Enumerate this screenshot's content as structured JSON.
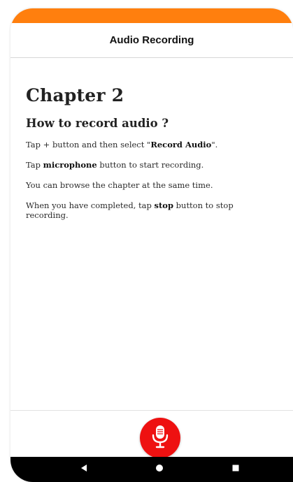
{
  "app_bar": {
    "title": "Audio Recording"
  },
  "content": {
    "chapter_title": "Chapter 2",
    "section_title": "How to record audio ?",
    "paragraphs": [
      {
        "segments": [
          {
            "text": "Tap + button and then select \"",
            "bold": false
          },
          {
            "text": "Record Audio",
            "bold": true
          },
          {
            "text": "\".",
            "bold": false
          }
        ]
      },
      {
        "segments": [
          {
            "text": "Tap ",
            "bold": false
          },
          {
            "text": "microphone",
            "bold": true
          },
          {
            "text": " button to start recording.",
            "bold": false
          }
        ]
      },
      {
        "segments": [
          {
            "text": "You can browse the chapter at the same time.",
            "bold": false
          }
        ]
      },
      {
        "segments": [
          {
            "text": "When you have completed, tap ",
            "bold": false
          },
          {
            "text": "stop",
            "bold": true
          },
          {
            "text": " button to stop recording.",
            "bold": false
          }
        ]
      }
    ]
  },
  "bottom_bar": {
    "record_button_icon": "microphone-icon"
  },
  "nav_bar": {
    "back_icon": "back-triangle-icon",
    "home_icon": "home-circle-icon",
    "recents_icon": "recents-square-icon"
  },
  "colors": {
    "status_bar": "#ff7f0e",
    "record_button": "#ee1111",
    "nav_bar": "#000000"
  }
}
